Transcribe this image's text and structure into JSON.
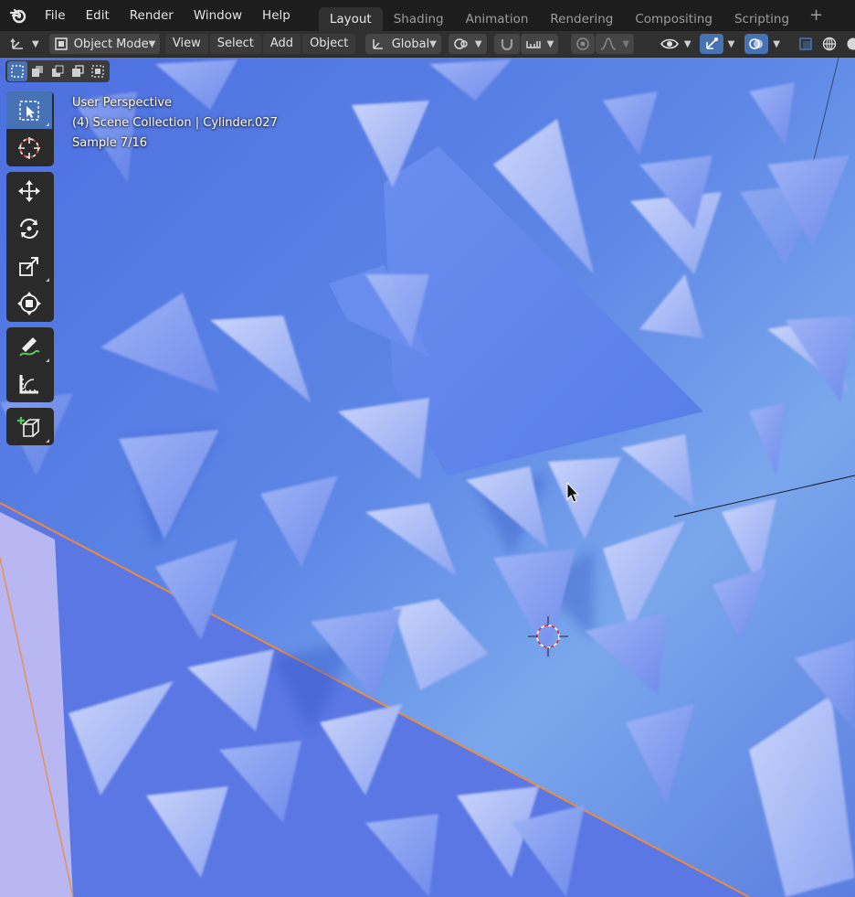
{
  "menu": {
    "items": [
      "File",
      "Edit",
      "Render",
      "Window",
      "Help"
    ]
  },
  "workspaces": {
    "tabs": [
      "Layout",
      "Shading",
      "Animation",
      "Rendering",
      "Compositing",
      "Scripting"
    ],
    "active": "Layout",
    "add_label": "+"
  },
  "header": {
    "mode": "Object Mode",
    "menus": [
      "View",
      "Select",
      "Add",
      "Object"
    ],
    "orientation": "Global"
  },
  "viewport": {
    "view_name": "User Perspective",
    "collection_info": "(4) Scene Collection | Cylinder.027",
    "sample_info": "Sample 7/16"
  },
  "colors": {
    "accent": "#4772b3",
    "topbar": "#1d1d1d",
    "header": "#303030",
    "scene_bg": "#5b7ee0",
    "plane_edge": "#f08a3a"
  },
  "icons": {
    "editor_type": "axes-icon",
    "mode": "cube-icon",
    "orientation": "transform-orientation-icon",
    "pivot": "pivot-icon",
    "snap": "magnet-icon",
    "proportional": "proportional-edit-icon",
    "visibility": "eye-icon",
    "gizmo": "gizmo-icon",
    "overlay": "overlay-icon",
    "xray": "xray-icon",
    "wireframe": "wireframe-shading-icon"
  }
}
